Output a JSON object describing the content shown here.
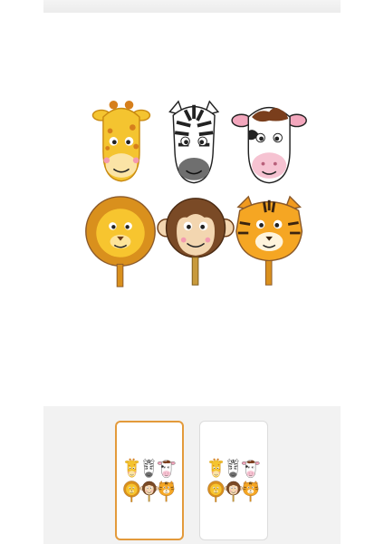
{
  "gallery": {
    "main_image": {
      "icon": "animal-foil-balloons-image",
      "alt": ""
    },
    "thumbnails": [
      {
        "icon": "animal-foil-balloons-thumbnail",
        "selected": true
      },
      {
        "icon": "animal-foil-balloons-thumbnail",
        "selected": false
      }
    ],
    "selected_index": 0
  },
  "colors": {
    "selected_border": "#e39a3b",
    "thumb_bar_bg": "#f2f2f2",
    "balloon_yellow": "#f4c430",
    "balloon_orange": "#f19a1f",
    "balloon_brown": "#8b5a2b"
  }
}
